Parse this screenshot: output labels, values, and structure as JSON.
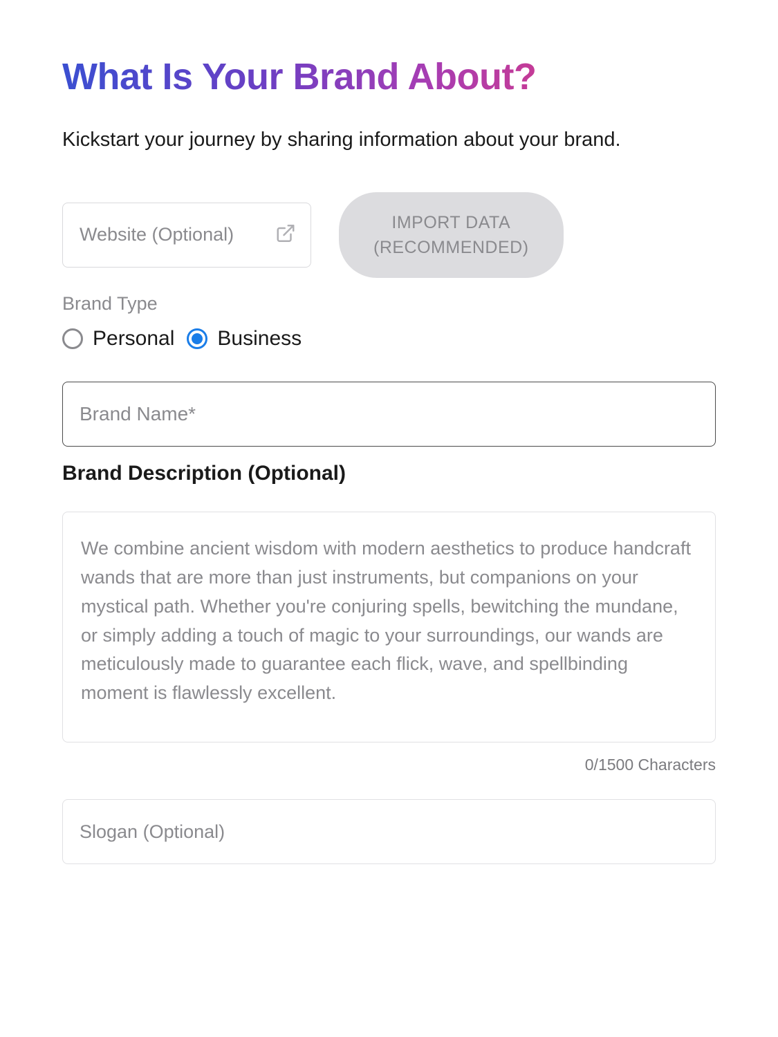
{
  "header": {
    "title": "What Is Your Brand About?",
    "subtitle": "Kickstart your journey by sharing information about your brand."
  },
  "website": {
    "placeholder": "Website (Optional)",
    "value": ""
  },
  "import_button": {
    "line1": "IMPORT DATA",
    "line2": "(RECOMMENDED)"
  },
  "brand_type": {
    "label": "Brand Type",
    "options": [
      {
        "label": "Personal",
        "selected": false
      },
      {
        "label": "Business",
        "selected": true
      }
    ]
  },
  "brand_name": {
    "placeholder": "Brand Name*",
    "value": ""
  },
  "description": {
    "heading": "Brand Description (Optional)",
    "placeholder": "We combine ancient wisdom with modern aesthetics to produce handcraft wands that are more than just instruments, but companions on your mystical path. Whether you're conjuring spells, bewitching the mundane, or simply adding a touch of magic to your surroundings, our wands are meticulously made to guarantee each flick, wave, and spellbinding moment is flawlessly excellent.",
    "value": "",
    "counter": "0/1500 Characters"
  },
  "slogan": {
    "placeholder": "Slogan (Optional)",
    "value": ""
  }
}
